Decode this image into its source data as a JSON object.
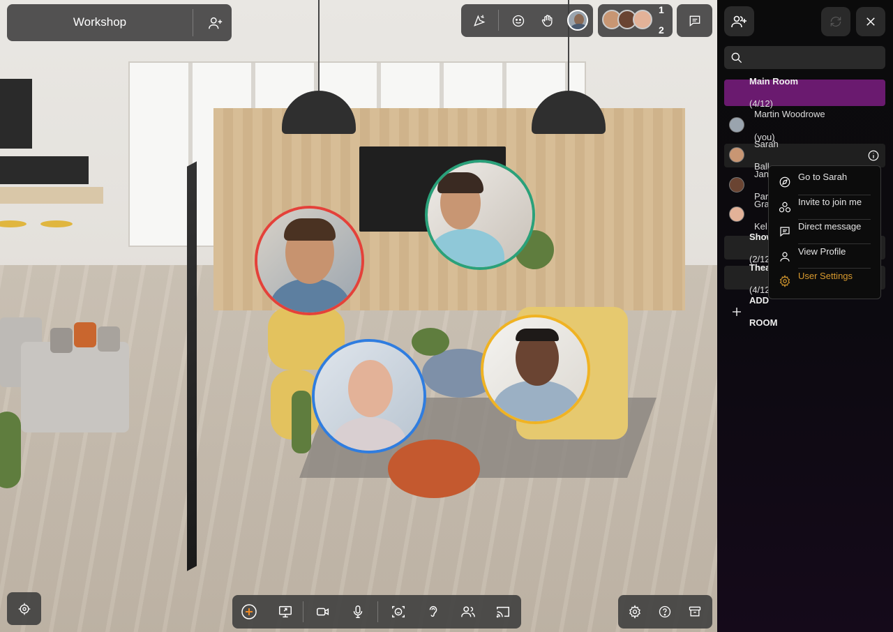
{
  "room": {
    "title": "Workshop"
  },
  "participants_top": {
    "count_a": "1",
    "count_b": "2"
  },
  "sidebar": {
    "search_placeholder": "",
    "main_room": {
      "name": "Main Room",
      "count": "(4/12)"
    },
    "users": [
      {
        "name": "Martin Woodrowe",
        "suffix": "(you)"
      },
      {
        "name": "Sarah",
        "suffix": ""
      },
      {
        "name": "Ball",
        "suffix": ""
      },
      {
        "name": "Jan",
        "suffix": ""
      },
      {
        "name": "Par",
        "suffix": ""
      },
      {
        "name": "Gra",
        "suffix": ""
      },
      {
        "name": "Kel",
        "suffix": ""
      }
    ],
    "rooms": [
      {
        "name": "Show",
        "count": "(2/12"
      },
      {
        "name": "Thea",
        "count": "(4/12"
      }
    ],
    "add_room_label_1": "ADD",
    "add_room_label_2": "ROOM"
  },
  "context_menu": {
    "items": [
      {
        "label": "Go to Sarah",
        "icon": "navigate-icon"
      },
      {
        "label": "Invite to join me",
        "icon": "invite-icon"
      },
      {
        "label": "Direct message",
        "icon": "message-icon"
      },
      {
        "label": "View Profile",
        "icon": "profile-icon"
      },
      {
        "label": "User Settings",
        "icon": "gear-icon",
        "color": "#d89a2e"
      }
    ]
  },
  "colors": {
    "accent_purple": "#6a1a6f",
    "ring_red": "#e4413a",
    "ring_green": "#2aa17a",
    "ring_blue": "#2f7de0",
    "ring_yellow": "#f0b323",
    "settings_orange": "#d89a2e"
  }
}
